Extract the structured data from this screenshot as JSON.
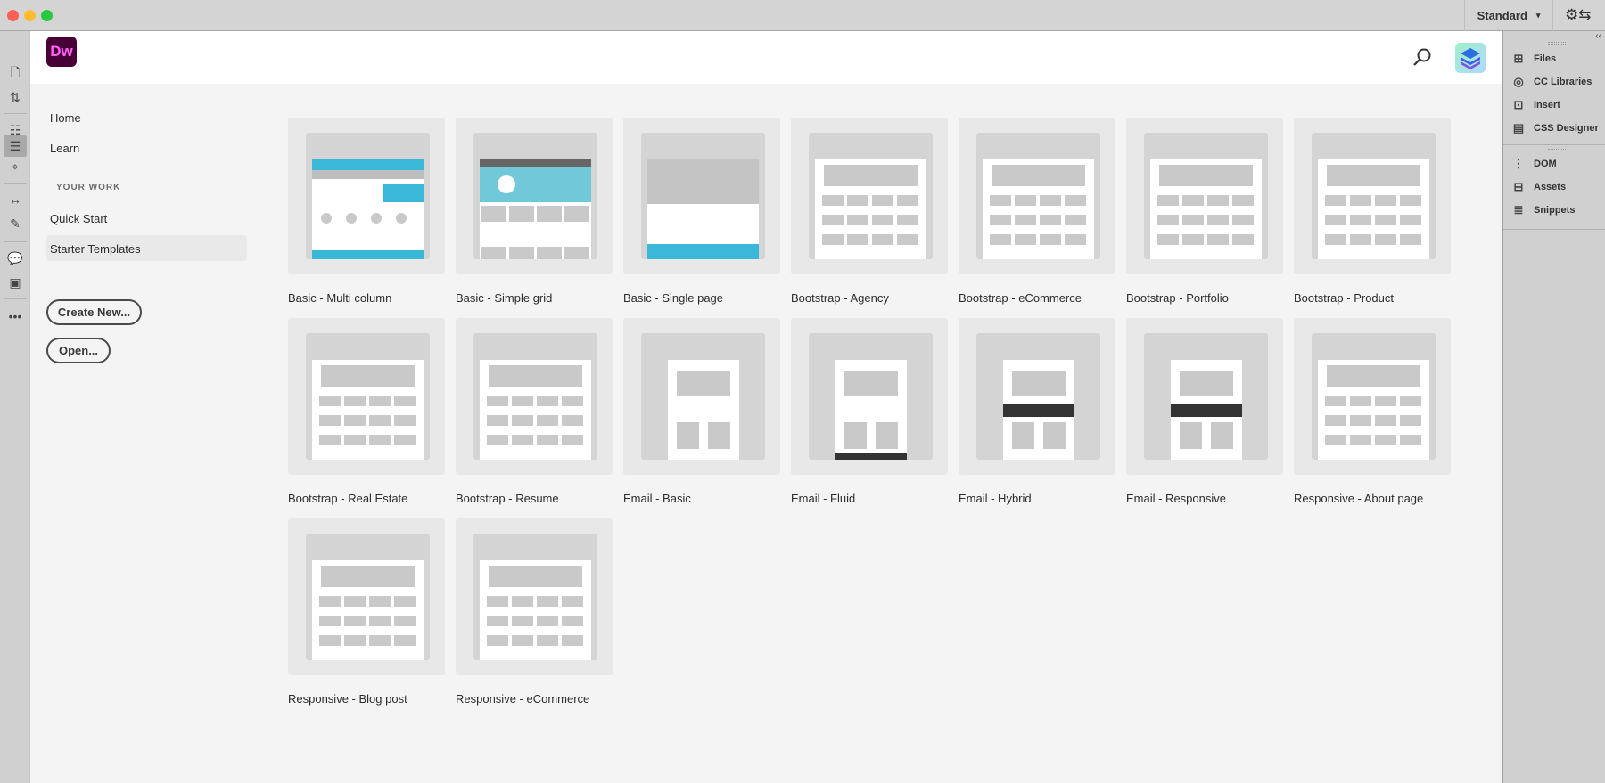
{
  "titlebar": {
    "workspace": "Standard",
    "workspace_caret": "▾",
    "settings_icon": "gear-swap-icon"
  },
  "app": {
    "logo_text": "Dw"
  },
  "header": {
    "search_icon": "search-icon",
    "avatar": "user-avatar"
  },
  "sidebar": {
    "items": [
      {
        "label": "Home"
      },
      {
        "label": "Learn"
      }
    ],
    "section_title": "YOUR WORK",
    "work_items": [
      {
        "label": "Quick Start"
      },
      {
        "label": "Starter Templates",
        "selected": true
      }
    ],
    "create_new": "Create New...",
    "open": "Open..."
  },
  "templates": [
    {
      "label": "Basic - Multi column"
    },
    {
      "label": "Basic - Simple grid"
    },
    {
      "label": "Basic - Single page"
    },
    {
      "label": "Bootstrap - Agency"
    },
    {
      "label": "Bootstrap - eCommerce"
    },
    {
      "label": "Bootstrap - Portfolio"
    },
    {
      "label": "Bootstrap - Product"
    },
    {
      "label": "Bootstrap - Real Estate"
    },
    {
      "label": "Bootstrap - Resume"
    },
    {
      "label": "Email - Basic"
    },
    {
      "label": "Email - Fluid"
    },
    {
      "label": "Email - Hybrid"
    },
    {
      "label": "Email - Responsive"
    },
    {
      "label": "Responsive - About page"
    },
    {
      "label": "Responsive - Blog post"
    },
    {
      "label": "Responsive - eCommerce"
    }
  ],
  "right_panel": {
    "group1": [
      {
        "label": "Files",
        "icon": "⊞"
      },
      {
        "label": "CC Libraries",
        "icon": "◎"
      },
      {
        "label": "Insert",
        "icon": "⊡"
      },
      {
        "label": "CSS Designer",
        "icon": "▤"
      }
    ],
    "group2": [
      {
        "label": "DOM",
        "icon": "⋮"
      },
      {
        "label": "Assets",
        "icon": "⊟"
      },
      {
        "label": "Snippets",
        "icon": "≣"
      }
    ],
    "collapse": "‹‹"
  },
  "colors": {
    "accent_cyan": "#3bb8d8",
    "logo_bg": "#470137",
    "logo_fg": "#ff61f6"
  }
}
